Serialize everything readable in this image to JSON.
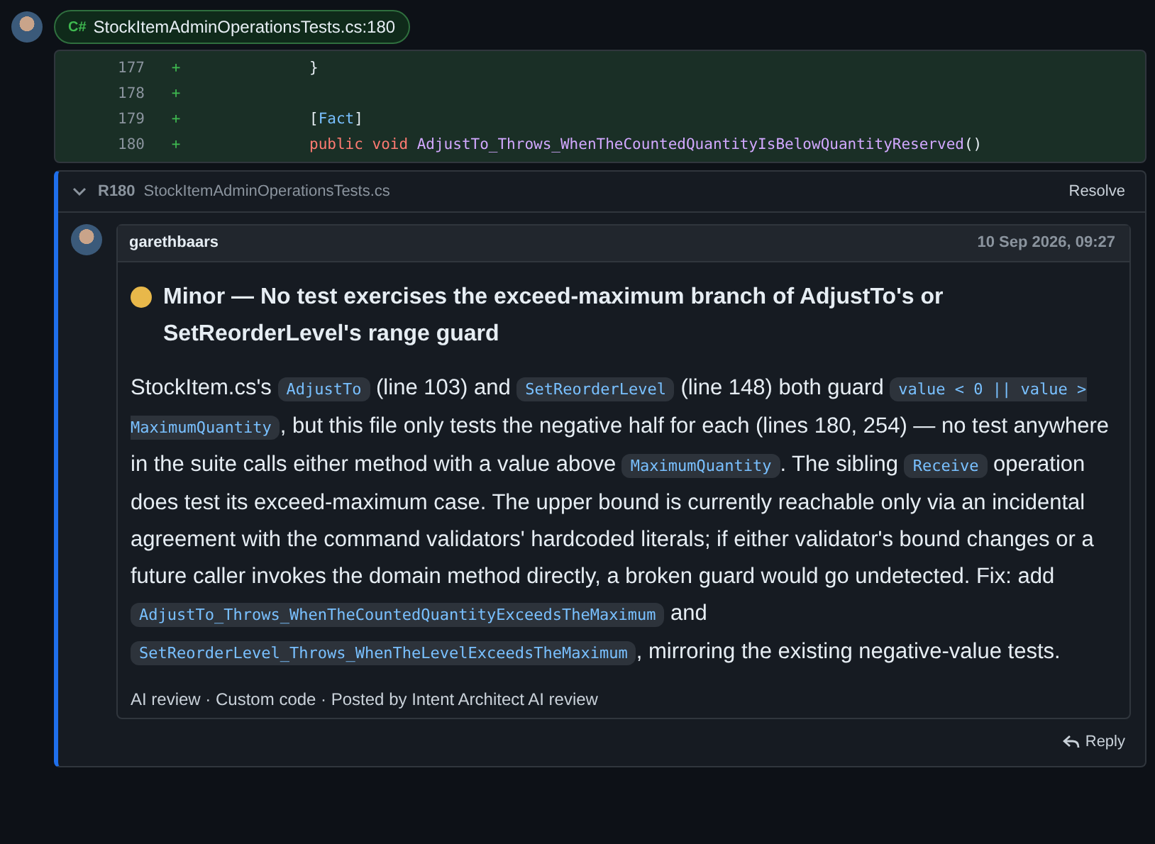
{
  "file_chip": {
    "language": "C#",
    "label": "StockItemAdminOperationsTests.cs:180"
  },
  "diff_lines": [
    {
      "number": "177",
      "marker": "+",
      "tokens": [
        {
          "kind": "punct",
          "text": "}"
        }
      ]
    },
    {
      "number": "178",
      "marker": "+"
    },
    {
      "number": "179",
      "marker": "+",
      "tokens": [
        {
          "kind": "punct",
          "text": "["
        },
        {
          "kind": "attribute",
          "text": "Fact"
        },
        {
          "kind": "punct",
          "text": "]"
        }
      ]
    },
    {
      "number": "180",
      "marker": "+",
      "tokens": [
        {
          "kind": "keyword",
          "text": "public void"
        },
        {
          "kind": "method",
          "text": "AdjustTo_Throws_WhenTheCountedQuantityIsBelowQuantityReserved"
        },
        {
          "kind": "punct",
          "text": "()"
        }
      ]
    }
  ],
  "thread": {
    "expanded": true,
    "line_ref": "R180",
    "file": "StockItemAdminOperationsTests.cs",
    "resolve_label": "Resolve",
    "comment": {
      "author": "garethbaars",
      "date": "10 Sep 2026, 09:27",
      "heading": "Minor — No test exercises the exceed-maximum branch of AdjustTo's or SetReorderLevel's range guard",
      "kind": "minor",
      "body": [
        {
          "kind": "text",
          "text": "StockItem.cs's "
        },
        {
          "kind": "code",
          "text": "AdjustTo"
        },
        {
          "kind": "text",
          "text": " (line 103) and "
        },
        {
          "kind": "code",
          "text": "SetReorderLevel"
        },
        {
          "kind": "text",
          "text": " (line 148) both guard "
        },
        {
          "kind": "code",
          "text": "value < 0 || value > MaximumQuantity"
        },
        {
          "kind": "text",
          "text": ", but this file only tests the negative half for each (lines 180, 254) — no test anywhere in the suite calls either method with a value above "
        },
        {
          "kind": "code",
          "text": "MaximumQuantity"
        },
        {
          "kind": "text",
          "text": ". The sibling "
        },
        {
          "kind": "code",
          "text": "Receive"
        },
        {
          "kind": "text",
          "text": " operation does test its exceed-maximum case. The upper bound is currently reachable only via an incidental agreement with the command validators' hardcoded literals; if either validator's bound changes or a future caller invokes the domain method directly, a broken guard would go undetected. Fix: add "
        },
        {
          "kind": "code",
          "text": "AdjustTo_Throws_WhenTheCountedQuantityExceedsTheMaximum"
        },
        {
          "kind": "text",
          "text": " and "
        },
        {
          "kind": "code",
          "text": "SetReorderLevel_Throws_WhenTheLevelExceedsTheMaximum"
        },
        {
          "kind": "text",
          "text": ", mirroring the existing negative-value tests."
        }
      ],
      "footer": "AI review · Custom code · Posted by Intent Architect AI review"
    },
    "reply_label": "Reply"
  }
}
